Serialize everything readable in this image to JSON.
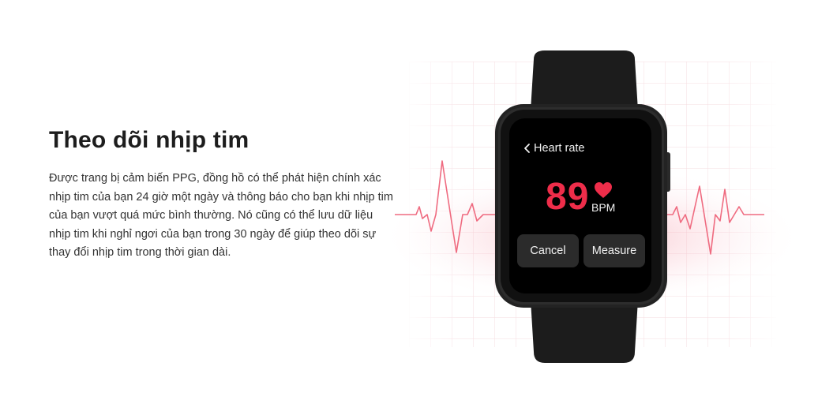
{
  "section": {
    "title": "Theo dõi nhịp tim",
    "description": "Được trang bị cảm biến PPG, đồng hồ có thể phát hiện chính xác nhịp tim của bạn 24 giờ một ngày và thông báo cho bạn khi nhịp tim của bạn vượt quá mức bình thường. Nó cũng có thể lưu dữ liệu nhịp tim khi nghỉ ngơi của bạn trong 30 ngày để giúp theo dõi sự thay đổi nhịp tim trong thời gian dài."
  },
  "watch": {
    "screen_title": "Heart rate",
    "back_icon": "chevron-left-icon",
    "heart_rate_value": "89",
    "heart_icon": "heart-icon",
    "unit": "BPM",
    "cancel_label": "Cancel",
    "measure_label": "Measure"
  },
  "colors": {
    "accent": "#ee2d4a",
    "ecg_line": "#ef6b80",
    "watch_body": "#1f1f1f",
    "screen": "#000000",
    "button_bg": "#2b2b2b"
  }
}
